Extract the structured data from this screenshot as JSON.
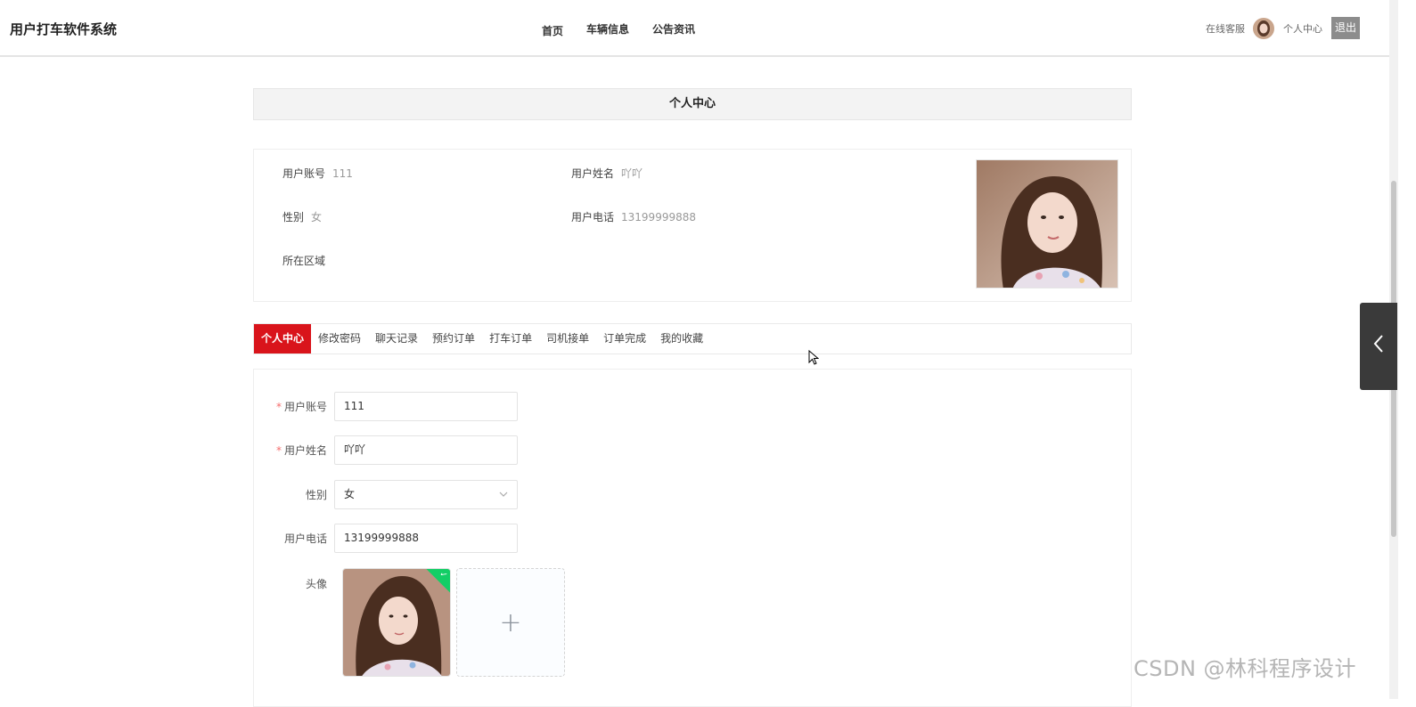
{
  "header": {
    "brand": "用户打车软件系统",
    "nav": [
      "首页",
      "车辆信息",
      "公告资讯"
    ],
    "service": "在线客服",
    "personal_center": "个人中心",
    "logout": "退出"
  },
  "page": {
    "title": "个人中心"
  },
  "info": {
    "account_label": "用户账号",
    "account_value": "111",
    "name_label": "用户姓名",
    "name_value": "吖吖",
    "gender_label": "性别",
    "gender_value": "女",
    "phone_label": "用户电话",
    "phone_value": "13199999888",
    "region_label": "所在区域",
    "region_value": ""
  },
  "tabs": [
    "个人中心",
    "修改密码",
    "聊天记录",
    "预约订单",
    "打车订单",
    "司机接单",
    "订单完成",
    "我的收藏"
  ],
  "form": {
    "account_label": "用户账号",
    "account_value": "111",
    "name_label": "用户姓名",
    "name_value": "吖吖",
    "gender_label": "性别",
    "gender_value": "女",
    "phone_label": "用户电话",
    "phone_value": "13199999888",
    "avatar_label": "头像",
    "upload_plus": "+"
  },
  "watermark": "CSDN @林科程序设计",
  "icons": {
    "side_toggle": "chevron-left-icon",
    "upload_success": "check-icon",
    "select_arrow": "chevron-down-icon"
  },
  "colors": {
    "active_tab": "#d9141b",
    "logout_bg": "#8c8c8c",
    "upload_success": "#13ce66"
  }
}
